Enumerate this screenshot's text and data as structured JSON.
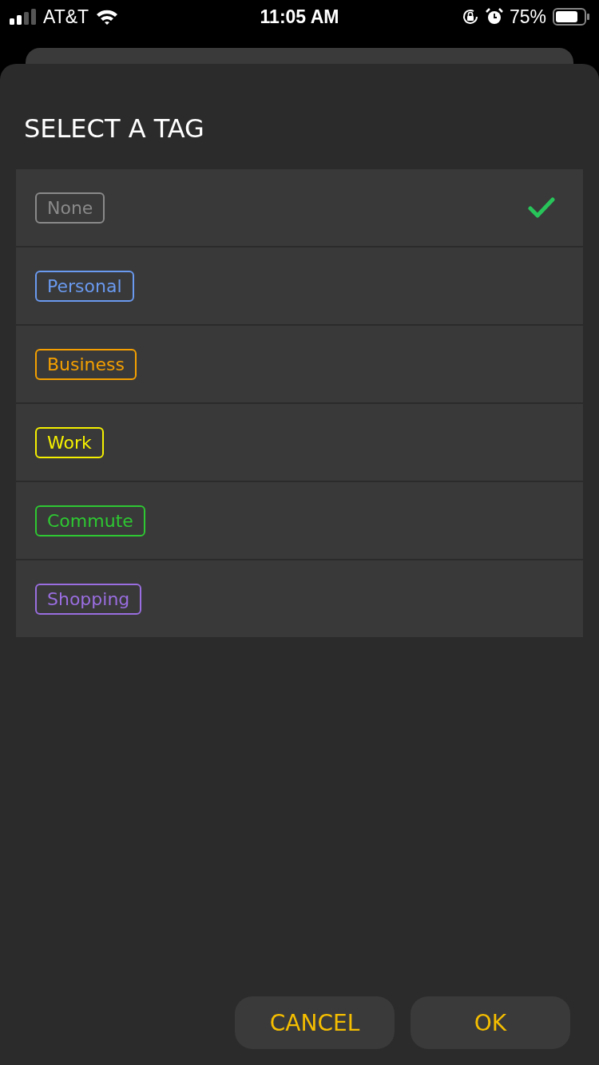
{
  "status_bar": {
    "carrier": "AT&T",
    "time": "11:05 AM",
    "battery": "75%"
  },
  "dialog": {
    "title": "SELECT A TAG",
    "tags": [
      {
        "label": "None",
        "color": "#8a8a8a",
        "selected": true
      },
      {
        "label": "Personal",
        "color": "#6a9af0",
        "selected": false
      },
      {
        "label": "Business",
        "color": "#f5a000",
        "selected": false
      },
      {
        "label": "Work",
        "color": "#f5f000",
        "selected": false
      },
      {
        "label": "Commute",
        "color": "#2ec832",
        "selected": false
      },
      {
        "label": "Shopping",
        "color": "#9a6ee0",
        "selected": false
      }
    ],
    "buttons": [
      "CANCEL",
      "OK"
    ]
  }
}
